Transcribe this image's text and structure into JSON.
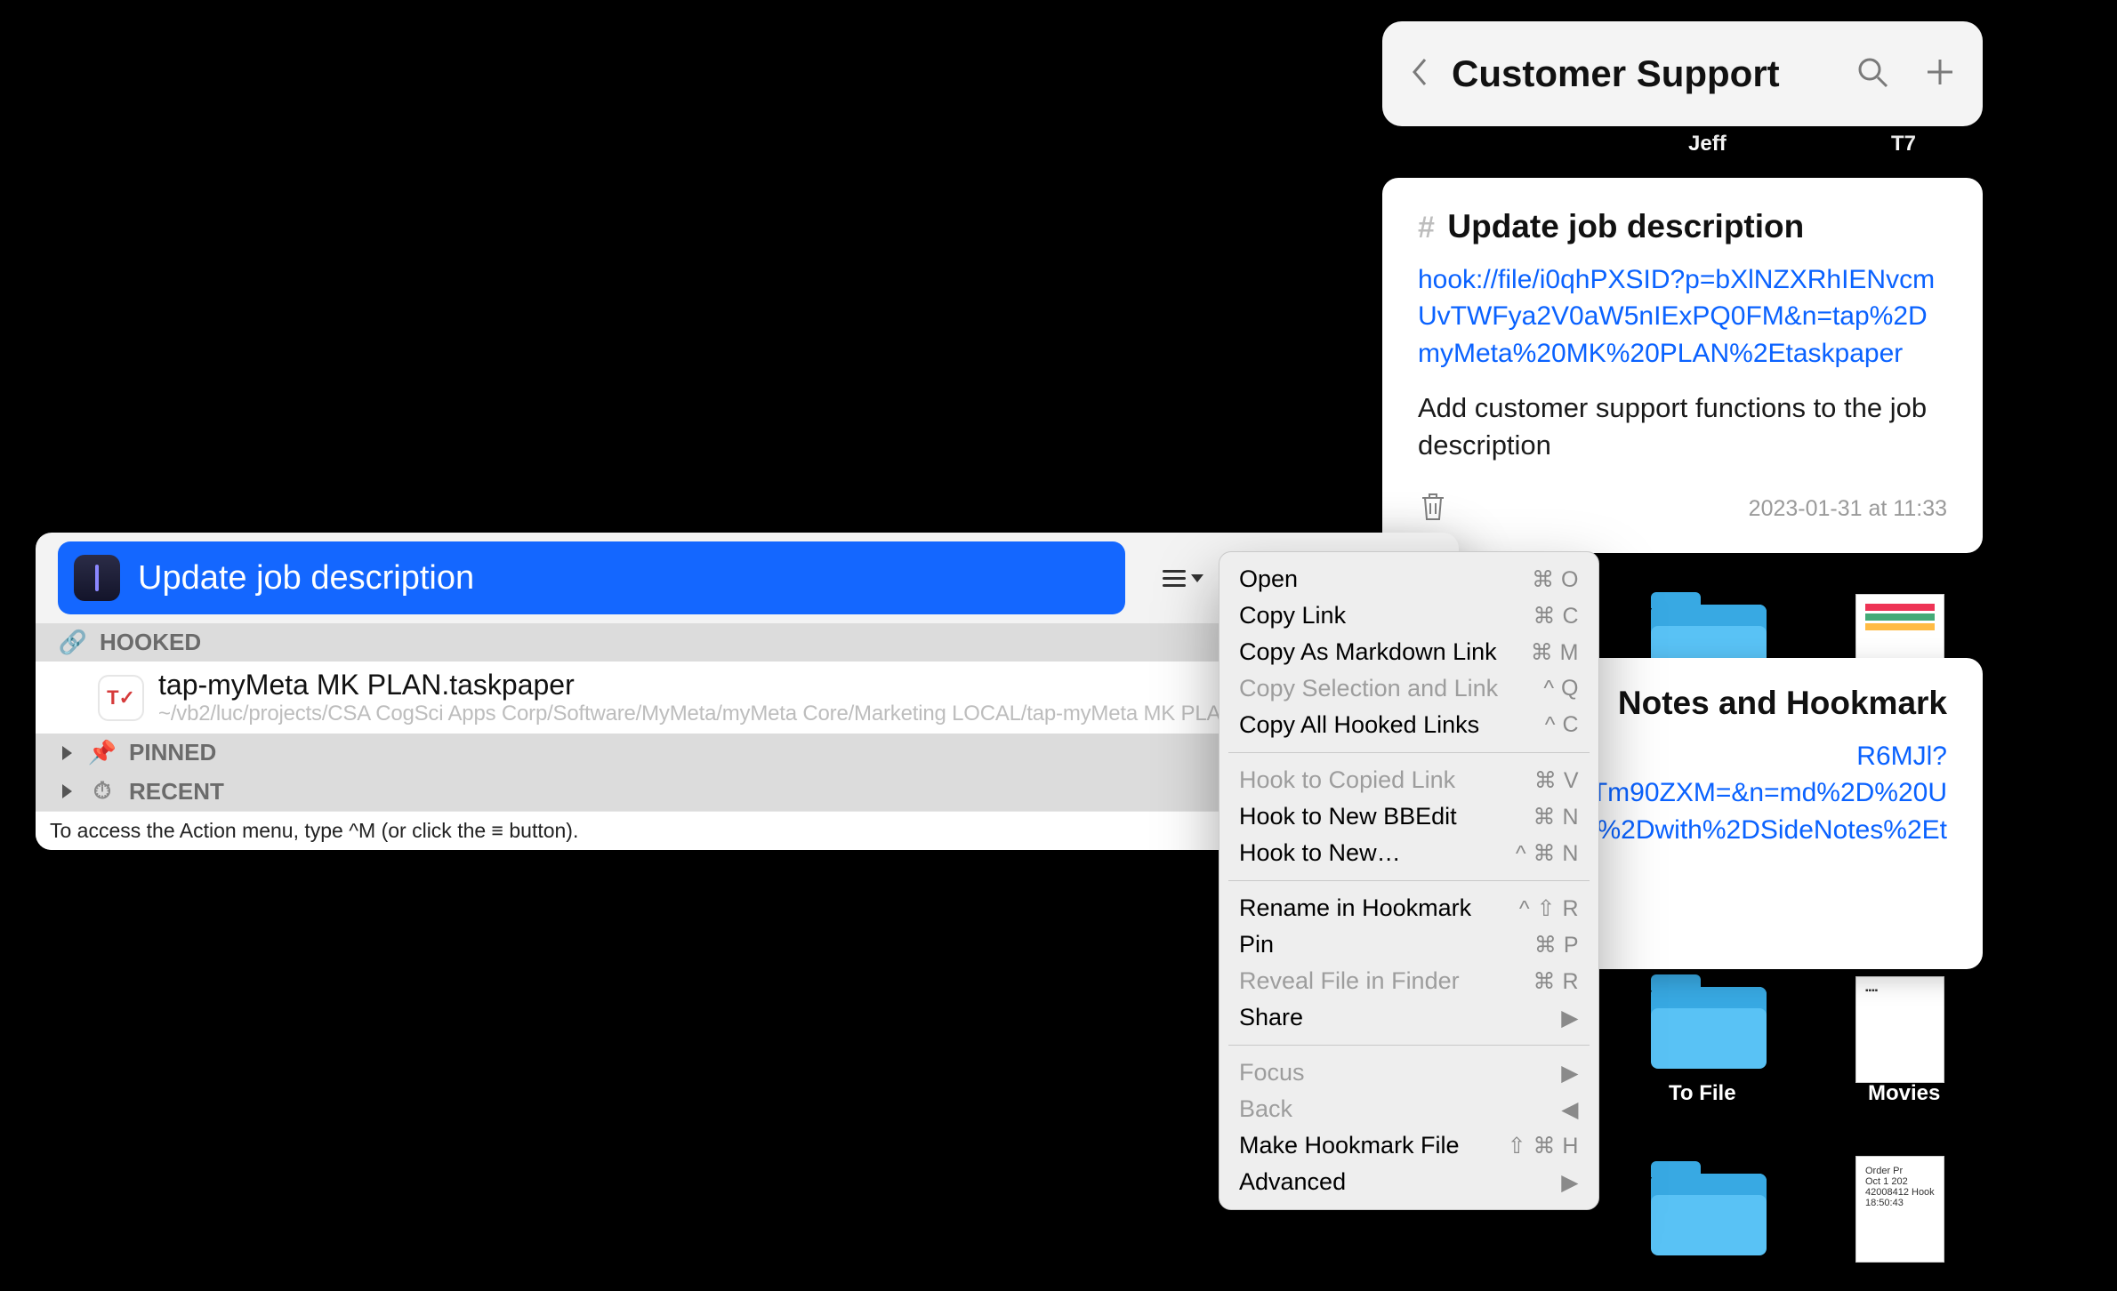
{
  "desktop_labels": {
    "jeff": "Jeff",
    "t7": "T7",
    "tofile": "To File",
    "movies": "Movies"
  },
  "side_header": {
    "title": "Customer Support"
  },
  "note1": {
    "title": "Update job description",
    "link": "hook://file/i0qhPXSID?p=bXlNZXRhIENvcmUvTWFya2V0aW5nIExPQ0FM&n=tap%2DmyMeta%20MK%20PLAN%2Etaskpaper",
    "body": "Add customer support functions to the job description",
    "timestamp": "2023-01-31 at 11:33"
  },
  "note2": {
    "title_partial": "Notes and Hookmark",
    "link_partial": "R6MJl?\nRlTm90ZXM=&n=md%2D%20U\nrk%2Dwith%2DSideNotes%2Et"
  },
  "hook": {
    "title": "Update job description",
    "sections": {
      "hooked": "HOOKED",
      "pinned": "PINNED",
      "recent": "RECENT"
    },
    "file": {
      "app_glyph": "T✓",
      "name": "tap-myMeta MK PLAN.taskpaper",
      "path": "~/vb2/luc/projects/CSA CogSci Apps Corp/Software/MyMeta/myMeta Core/Marketing LOCAL/tap-myMeta MK PLAN"
    },
    "hint": "To access the Action menu, type ^M (or click the ≡ button)."
  },
  "menu": [
    {
      "label": "Open",
      "shortcut": "⌘ O"
    },
    {
      "label": "Copy Link",
      "shortcut": "⌘ C"
    },
    {
      "label": "Copy As Markdown Link",
      "shortcut": "⌘ M"
    },
    {
      "label": "Copy Selection and Link",
      "shortcut": "^ Q",
      "disabled": true
    },
    {
      "label": "Copy All Hooked Links",
      "shortcut": "^ C"
    },
    {
      "sep": true
    },
    {
      "label": "Hook to Copied Link",
      "shortcut": "⌘ V",
      "disabled": true
    },
    {
      "label": "Hook to New BBEdit",
      "shortcut": "⌘ N"
    },
    {
      "label": "Hook to New…",
      "shortcut": "^ ⌘ N"
    },
    {
      "sep": true
    },
    {
      "label": "Rename in Hookmark",
      "shortcut": "^ ⇧ R"
    },
    {
      "label": "Pin",
      "shortcut": "⌘ P"
    },
    {
      "label": "Reveal File in Finder",
      "shortcut": "⌘ R",
      "disabled": true
    },
    {
      "label": "Share",
      "submenu": true
    },
    {
      "sep": true
    },
    {
      "label": "Focus",
      "submenu": true,
      "disabled": true
    },
    {
      "label": "Back",
      "submenu_back": true,
      "disabled": true
    },
    {
      "label": "Make Hookmark File",
      "shortcut": "⇧ ⌘ H"
    },
    {
      "label": "Advanced",
      "submenu": true
    }
  ]
}
